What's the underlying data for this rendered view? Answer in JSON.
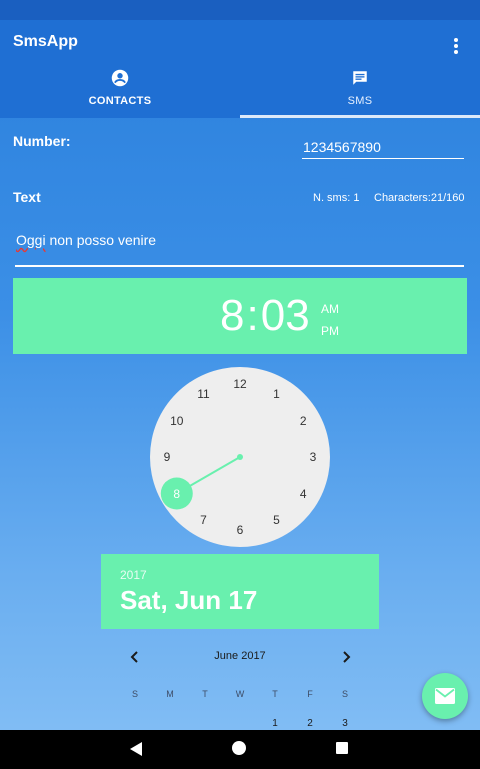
{
  "app": {
    "title": "SmsApp"
  },
  "tabs": [
    {
      "label": "CONTACTS",
      "icon": "account-circle-icon"
    },
    {
      "label": "SMS",
      "icon": "message-icon"
    }
  ],
  "form": {
    "number_label": "Number:",
    "number_value": "1234567890",
    "text_label": "Text",
    "sms_count": "N. sms: 1",
    "char_count": "Characters:21/160",
    "message_word1": "Oggi",
    "message_rest": " non posso venire"
  },
  "time_picker": {
    "hour": "8",
    "colon": ":",
    "minute": "03",
    "am": "AM",
    "pm": "PM",
    "numbers": [
      "12",
      "1",
      "2",
      "3",
      "4",
      "5",
      "6",
      "7",
      "8",
      "9",
      "10",
      "11"
    ],
    "selected_hour": "8"
  },
  "date_picker": {
    "year": "2017",
    "date": "Sat, Jun 17",
    "month_label": "June 2017",
    "weekdays": [
      "S",
      "M",
      "T",
      "W",
      "T",
      "F",
      "S"
    ],
    "first_row": [
      "1",
      "2",
      "3"
    ]
  },
  "colors": {
    "app_bar": "#1f6fd3",
    "accent": "#69f0ae"
  },
  "fab": {
    "icon": "email-icon"
  }
}
